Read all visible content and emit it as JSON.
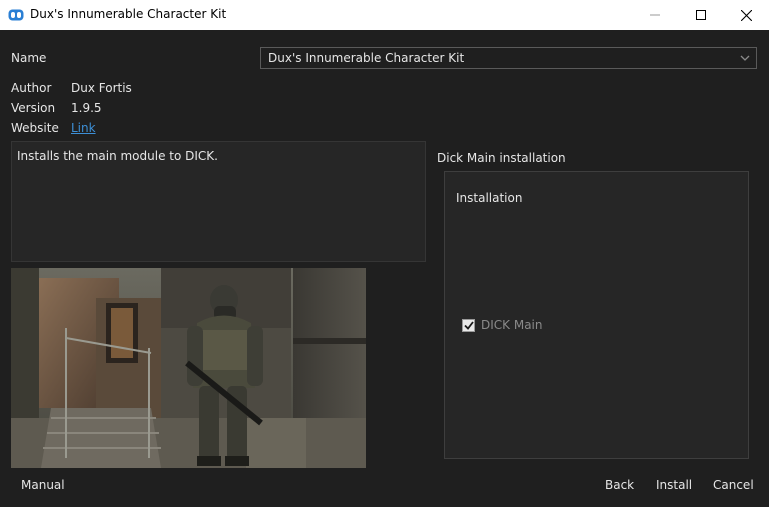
{
  "window": {
    "title": "Dux's Innumerable Character Kit",
    "icon": "app-logo-icon",
    "controls": [
      "minimize-icon",
      "maximize-icon",
      "close-icon"
    ]
  },
  "form": {
    "name_label": "Name",
    "name_value": "Dux's Innumerable Character Kit",
    "author_label": "Author",
    "author_value": "Dux Fortis",
    "version_label": "Version",
    "version_value": "1.9.5",
    "website_label": "Website",
    "website_link": "Link",
    "description": "Installs the main module to DICK."
  },
  "options": {
    "section_title": "Dick Main installation",
    "group_title": "Installation",
    "items": [
      {
        "label": "DICK Main",
        "checked": true,
        "enabled": false
      }
    ]
  },
  "buttons": {
    "manual": "Manual",
    "back": "Back",
    "install": "Install",
    "cancel": "Cancel"
  },
  "colors": {
    "background": "#1f1f1f",
    "panel": "#262626",
    "link": "#3d8fd6"
  }
}
